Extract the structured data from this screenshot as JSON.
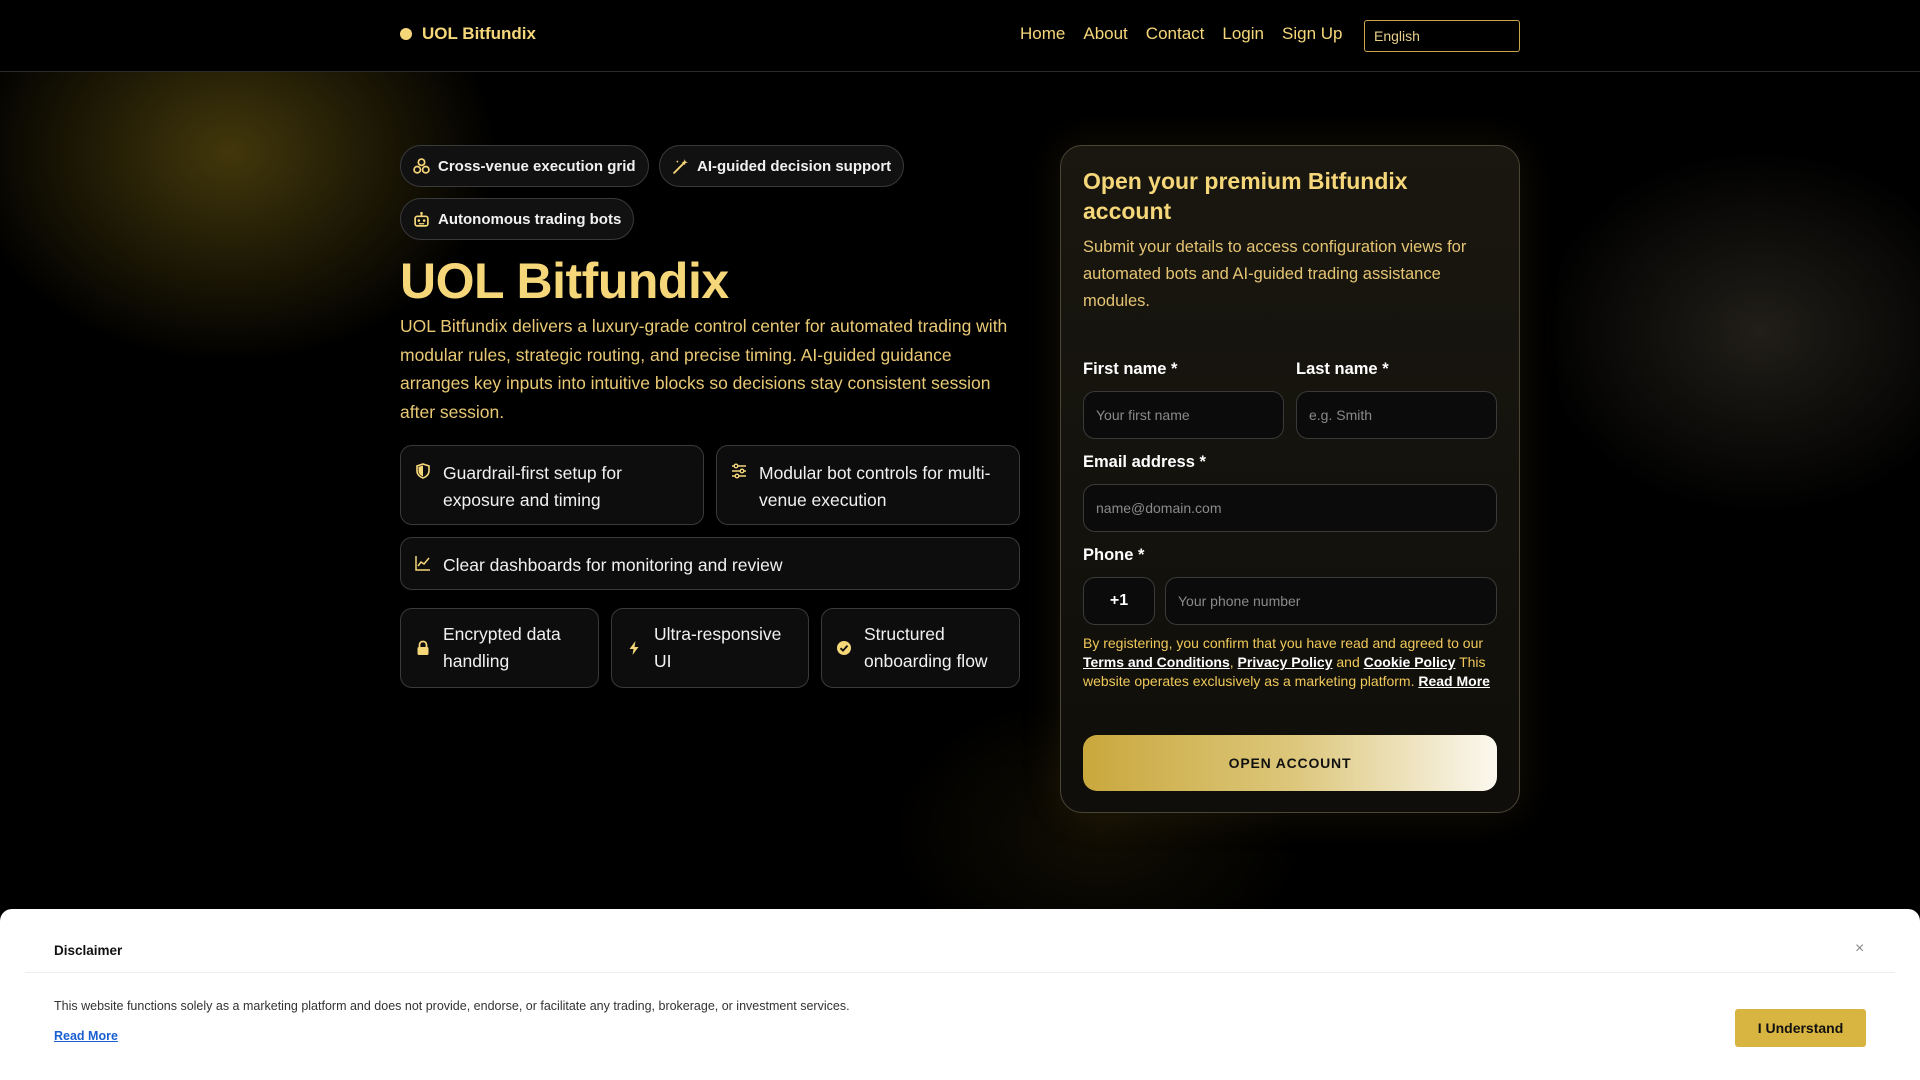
{
  "brand": {
    "name": "UOL Bitfundix"
  },
  "nav": {
    "links": [
      "Home",
      "About",
      "Contact",
      "Login",
      "Sign Up"
    ],
    "language": "English"
  },
  "hero": {
    "pills": [
      {
        "label": "Cross-venue execution grid",
        "icon": "grid-nodes-icon"
      },
      {
        "label": "AI-guided decision support",
        "icon": "magic-wand-icon"
      },
      {
        "label": "Autonomous trading bots",
        "icon": "robot-icon"
      }
    ],
    "title": "UOL Bitfundix",
    "description": "UOL Bitfundix delivers a luxury-grade control center for automated trading with modular rules, strategic routing, and precise timing. AI-guided guidance arranges key inputs into intuitive blocks so decisions stay consistent session after session.",
    "features": [
      {
        "label": "Guardrail-first setup for exposure and timing",
        "icon": "shield-icon"
      },
      {
        "label": "Modular bot controls for multi-venue execution",
        "icon": "sliders-icon"
      },
      {
        "label": "Clear dashboards for monitoring and review",
        "icon": "line-chart-icon"
      }
    ],
    "badges": [
      {
        "label": "Encrypted data handling",
        "icon": "lock-icon"
      },
      {
        "label": "Ultra-responsive UI",
        "icon": "lightning-icon"
      },
      {
        "label": "Structured onboarding flow",
        "icon": "check-circle-icon"
      }
    ]
  },
  "form": {
    "title": "Open your premium Bitfundix account",
    "subtitle": "Submit your details to access configuration views for automated bots and AI-guided trading assistance modules.",
    "first_name_label": "First name *",
    "first_name_placeholder": "Your first name",
    "last_name_label": "Last name *",
    "last_name_placeholder": "e.g. Smith",
    "email_label": "Email address *",
    "email_placeholder": "name@domain.com",
    "phone_label": "Phone *",
    "phone_prefix": "+1",
    "phone_placeholder": "Your phone number",
    "consent_prefix": "By registering, you confirm that you have read and agreed to our",
    "terms_link": "Terms and Conditions",
    "privacy_link": "Privacy Policy",
    "and_text": "and",
    "cookie_link": "Cookie Policy",
    "marketing_text": "This website operates exclusively as a marketing platform.",
    "read_more": "Read More",
    "submit": "OPEN ACCOUNT"
  },
  "disclaimer": {
    "title": "Disclaimer",
    "close_glyph": "×",
    "text": "This website functions solely as a marketing platform and does not provide, endorse, or facilitate any trading, brokerage, or investment services.",
    "read_more": "Read More",
    "button": "I Understand"
  },
  "colors": {
    "accent": "#f5d77a",
    "background": "#000000",
    "button_gold": "#d8b440"
  }
}
